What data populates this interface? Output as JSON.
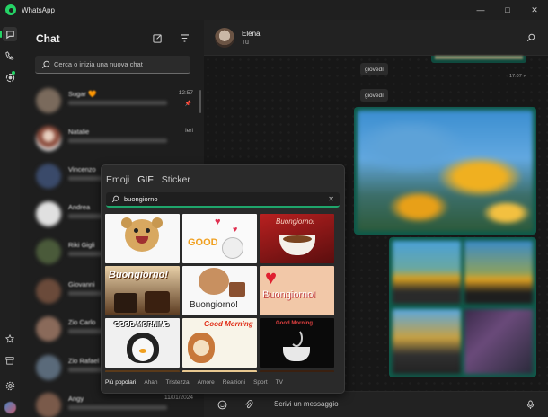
{
  "window": {
    "title": "WhatsApp",
    "controls": [
      "—",
      "□",
      "✕"
    ]
  },
  "rail": {
    "icons": [
      "chats-icon",
      "calls-icon",
      "status-icon",
      "starred-icon",
      "archive-icon",
      "settings-icon",
      "profile-icon"
    ]
  },
  "chat_list": {
    "title": "Chat",
    "search_placeholder": "Cerca o inizia una nuova chat",
    "items": [
      {
        "name": "Sugar 🧡",
        "time": "12:57",
        "pinned": true
      },
      {
        "name": "Natalie",
        "time": "Ieri",
        "pinned": false
      },
      {
        "name": "Vincenzo",
        "time": "",
        "pinned": false
      },
      {
        "name": "Andrea",
        "time": "",
        "pinned": false
      },
      {
        "name": "Riki Gigli",
        "time": "",
        "pinned": false
      },
      {
        "name": "Giovanni",
        "time": "",
        "pinned": false
      },
      {
        "name": "Zio Carlo",
        "time": "",
        "pinned": false
      },
      {
        "name": "Zio Rafael",
        "time": "",
        "pinned": false
      },
      {
        "name": "Angy",
        "time": "11/01/2024",
        "pinned": false
      }
    ]
  },
  "conversation": {
    "contact_name": "Elena",
    "contact_subtitle": "Tu",
    "day_labels": [
      "giovedì",
      "giovedì"
    ],
    "message_time": "17:07 ✓",
    "composer_placeholder": "Scrivi un messaggio"
  },
  "gif_picker": {
    "tabs": [
      "Emoji",
      "GIF",
      "Sticker"
    ],
    "active_tab": "GIF",
    "search_value": "buongiorno",
    "gif_captions": [
      "",
      "GOOD",
      "Buongiorno!",
      "Buongiorno!",
      "Buongiorno!",
      "Buongiorno!",
      "GOOD MORNING",
      "Good Morning",
      "Good Morning"
    ],
    "categories": [
      "Più popolari",
      "Ahah",
      "Tristezza",
      "Amore",
      "Reazioni",
      "Sport",
      "TV"
    ],
    "active_category": "Più popolari"
  },
  "colors": {
    "accent": "#25d366",
    "sent_bubble": "#0f5a4a",
    "search_underline": "#1fa56b"
  }
}
